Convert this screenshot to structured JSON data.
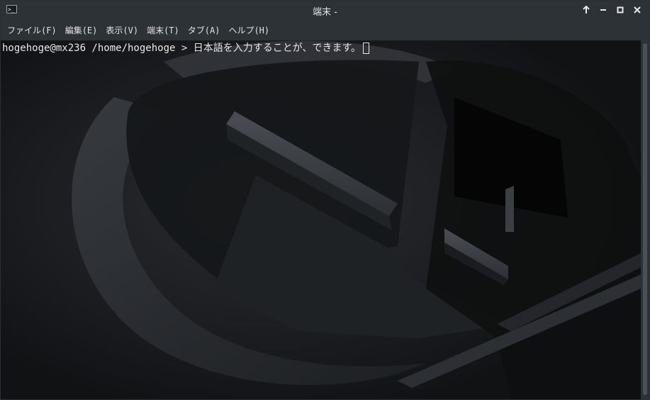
{
  "window": {
    "title": "端末 -",
    "icon": "terminal-icon",
    "controls": [
      "keep-above-icon",
      "minimize-icon",
      "maximize-icon",
      "close-icon"
    ]
  },
  "menu": {
    "file": "ファイル(F)",
    "edit": "編集(E)",
    "view": "表示(V)",
    "terminal": "端末(T)",
    "tabs": "タブ(A)",
    "help": "ヘルプ(H)"
  },
  "terminal": {
    "prompt": "hogehoge@mx236 /home/hogehoge > ",
    "input": "日本語を入力することが、できます。",
    "text_color": "#e8e8e8",
    "background_color": "#17191b"
  }
}
